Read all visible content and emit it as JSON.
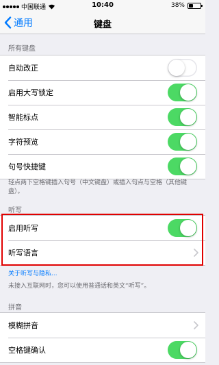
{
  "status_bar": {
    "carrier": "中国联通",
    "time": "10:40",
    "battery": "38%",
    "battery_level": 0.38
  },
  "nav": {
    "back_label": "通用",
    "title": "键盘"
  },
  "sections": {
    "all_keyboards": {
      "header": "所有键盘",
      "rows": [
        {
          "label": "自动改正",
          "control": "toggle",
          "state": "off"
        },
        {
          "label": "启用大写锁定",
          "control": "toggle",
          "state": "on"
        },
        {
          "label": "智能标点",
          "control": "toggle",
          "state": "on"
        },
        {
          "label": "字符预览",
          "control": "toggle",
          "state": "on"
        },
        {
          "label": "句号快捷键",
          "control": "toggle",
          "state": "on"
        }
      ],
      "footer": "轻点两下空格键插入句号（中文键盘）或插入句点与空格（其他键盘）。"
    },
    "dictation": {
      "header": "听写",
      "rows": [
        {
          "label": "启用听写",
          "control": "toggle",
          "state": "on"
        },
        {
          "label": "听写语言",
          "control": "disclosure"
        }
      ],
      "link": "关于听写与隐私...",
      "footer": "未接入互联网时，您可以使用普通话和英文“听写”。"
    },
    "pinyin": {
      "header": "拼音",
      "rows": [
        {
          "label": "模糊拼音",
          "control": "disclosure"
        },
        {
          "label": "空格键确认",
          "control": "toggle",
          "state": "on"
        }
      ]
    }
  },
  "colors": {
    "accent": "#007aff",
    "toggle_on": "#4cd964",
    "highlight": "#e00000"
  }
}
